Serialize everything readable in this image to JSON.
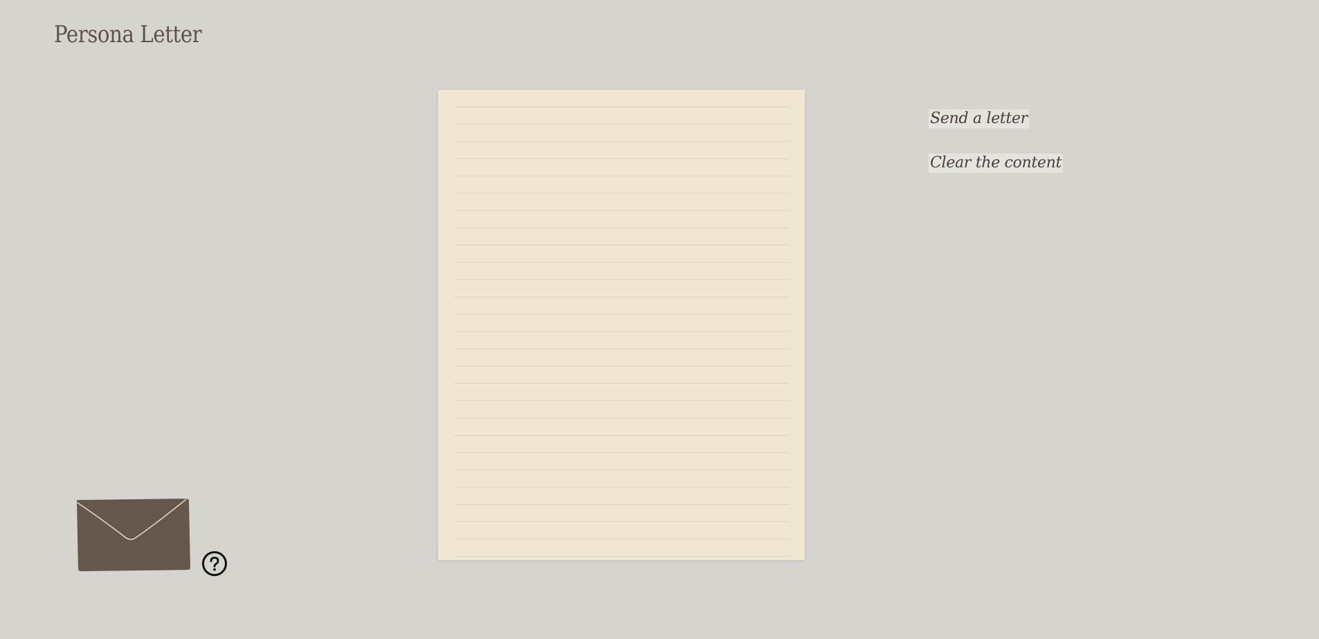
{
  "app": {
    "title": "Persona Letter"
  },
  "letter": {
    "content": "",
    "placeholder": ""
  },
  "actions": {
    "send_label": "Send a letter",
    "clear_label": "Clear the content"
  },
  "icons": {
    "envelope": "envelope-icon",
    "help": "help-circle-icon"
  },
  "colors": {
    "background": "#d5d4cf",
    "paper": "#f1e6d2",
    "paper_lines": "#dfd5c1",
    "title_text": "#5e5149",
    "envelope": "#66574c",
    "envelope_flap_line": "#e9d8c4",
    "action_highlight": "#e4e3df"
  }
}
